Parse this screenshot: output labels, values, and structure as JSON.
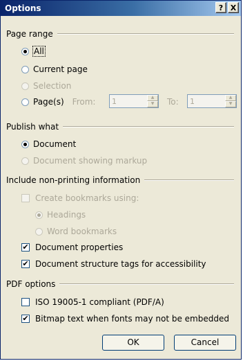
{
  "window": {
    "title": "Options",
    "help_label": "?",
    "close_label": "X"
  },
  "page_range": {
    "header": "Page range",
    "all": "All",
    "current_page": "Current page",
    "selection": "Selection",
    "pages": "Page(s)",
    "from_label": "From:",
    "from_value": "1",
    "to_label": "To:",
    "to_value": "1"
  },
  "publish_what": {
    "header": "Publish what",
    "document": "Document",
    "document_markup": "Document showing markup"
  },
  "non_printing": {
    "header": "Include non-printing information",
    "create_bookmarks": "Create bookmarks using:",
    "headings": "Headings",
    "word_bookmarks": "Word bookmarks",
    "doc_properties": "Document properties",
    "structure_tags": "Document structure tags for accessibility"
  },
  "pdf_options": {
    "header": "PDF options",
    "iso": "ISO 19005-1 compliant (PDF/A)",
    "bitmap_text": "Bitmap text when fonts may not be embedded"
  },
  "buttons": {
    "ok": "OK",
    "cancel": "Cancel"
  },
  "checkmark": "✔",
  "state": {
    "page_range_selected": "All",
    "publish_selected": "Document",
    "bookmarks_using_selected": "Headings",
    "create_bookmarks_checked": false,
    "doc_properties_checked": true,
    "structure_tags_checked": true,
    "iso_checked": false,
    "bitmap_text_checked": true
  }
}
